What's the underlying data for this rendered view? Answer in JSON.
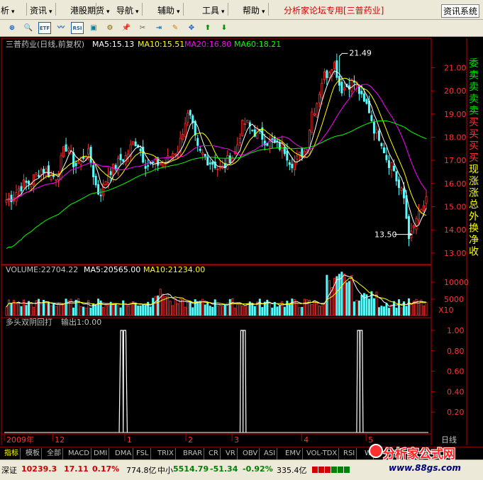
{
  "menu": {
    "items": [
      {
        "label": "析",
        "x": 1
      },
      {
        "label": "资讯",
        "x": 42
      },
      {
        "label": "港股期货",
        "x": 99
      },
      {
        "label": "导航",
        "x": 164
      },
      {
        "label": "辅助",
        "x": 222
      },
      {
        "label": "工具",
        "x": 285
      },
      {
        "label": "帮助",
        "x": 342
      }
    ],
    "brand": "分析家论坛专用",
    "brand_stock": "[三普药业]",
    "topright": "资讯系统"
  },
  "toolbar": {
    "buttons": [
      {
        "name": "zoom-icon",
        "glyph": "⊕"
      },
      {
        "name": "search-icon",
        "glyph": "🔍"
      },
      {
        "name": "etf-icon",
        "glyph": "ETF"
      },
      {
        "name": "trend-icon",
        "glyph": "〰"
      },
      {
        "name": "rsi-icon",
        "glyph": "RSI"
      },
      {
        "name": "window-icon",
        "glyph": "▣"
      },
      {
        "name": "tools-icon",
        "glyph": "⚙"
      },
      {
        "name": "pin-icon",
        "glyph": "📌"
      },
      {
        "name": "wrench-icon",
        "glyph": "✂"
      },
      {
        "name": "exit-icon",
        "glyph": "⇥"
      },
      {
        "name": "pencil-icon",
        "glyph": "✎"
      },
      {
        "name": "move-icon",
        "glyph": "✥"
      },
      {
        "name": "up-arrow-icon",
        "glyph": "⬆"
      },
      {
        "name": "down-arrow-icon",
        "glyph": "⬇"
      }
    ]
  },
  "colors": {
    "up": "#ff3232",
    "down": "#54fcfc",
    "ma5": "#ffffff",
    "ma10": "#ffff00",
    "ma20": "#ff00ff",
    "ma60": "#00ff00",
    "frame": "#c00000",
    "axis_text": "#ff3232"
  },
  "chart_data": {
    "type": "candlestick",
    "title": "三普药业(日线,前复权)",
    "ma_labels": [
      {
        "text": "MA5:15.13",
        "color": "#ffffff"
      },
      {
        "text": "MA10:15.51",
        "color": "#ffff00"
      },
      {
        "text": "MA20:16.80",
        "color": "#ff00ff"
      },
      {
        "text": "MA60:18.21",
        "color": "#00ff00"
      }
    ],
    "price_ticks": [
      "21.00",
      "20.00",
      "19.00",
      "18.00",
      "17.00",
      "16.00",
      "15.00",
      "14.00",
      "13.00"
    ],
    "ylim": [
      12.6,
      21.9
    ],
    "high_label": "21.49",
    "low_label": "13.50",
    "volume": {
      "label": "VOLUME:22704.22",
      "ma5": "MA5:20565.00",
      "ma10": "MA10:21234.00",
      "ticks": [
        "10000",
        "5000"
      ],
      "unit": "X10"
    },
    "indicator": {
      "label": "多头双阴回打",
      "output": "输出1:0.00",
      "ticks": [
        "1.00",
        "0.80",
        "0.60",
        "0.40",
        "0.20"
      ],
      "signals": [
        {
          "from": 0.271,
          "to": 0.29
        },
        {
          "from": 0.556,
          "to": 0.57
        },
        {
          "from": 0.831,
          "to": 0.846
        }
      ]
    },
    "date_labels": [
      {
        "text": "2009年",
        "pos": 0.0
      },
      {
        "text": "12",
        "pos": 0.114
      },
      {
        "text": "1",
        "pos": 0.284
      },
      {
        "text": "2",
        "pos": 0.428
      },
      {
        "text": "3",
        "pos": 0.537
      },
      {
        "text": "4",
        "pos": 0.701
      },
      {
        "text": "5",
        "pos": 0.853
      }
    ],
    "date_axis_right": "日线",
    "right_panel_labels": [
      "委",
      "卖",
      "卖",
      "卖",
      "卖",
      "买",
      "买",
      "买",
      "买",
      "现",
      "涨",
      "涨",
      "总",
      "外",
      "换",
      "净",
      "收"
    ]
  },
  "tabs": [
    {
      "label": "指标",
      "active": true
    },
    {
      "label": "模板",
      "active": false
    },
    {
      "label": "全部",
      "active": false
    },
    {
      "label": "MACD",
      "active": false
    },
    {
      "label": "DMI",
      "active": false
    },
    {
      "label": "DMA",
      "active": false
    },
    {
      "label": "FSL",
      "active": false
    },
    {
      "label": "TRIX",
      "active": false
    },
    {
      "label": "BRAR",
      "active": false
    },
    {
      "label": "CR",
      "active": false
    },
    {
      "label": "VR",
      "active": false
    },
    {
      "label": "OBV",
      "active": false
    },
    {
      "label": "ASI",
      "active": false
    },
    {
      "label": "EMV",
      "active": false
    },
    {
      "label": "VOL-TDX",
      "active": false
    },
    {
      "label": "RSI",
      "active": false
    },
    {
      "label": "W",
      "active": false
    }
  ],
  "status": {
    "sz_label": "深证",
    "sz_index": "10239.3",
    "sz_change": "17.11",
    "sz_pct": "0.17%",
    "sz_amount": "774.8亿",
    "zx_label": "中小",
    "zx_index": "5514.79",
    "zx_change": "-51.34",
    "zx_pct": "-0.92%",
    "zx_amount": "335.4亿"
  },
  "watermark": {
    "title": "分析家公式网",
    "url": "www.88gs.com"
  }
}
